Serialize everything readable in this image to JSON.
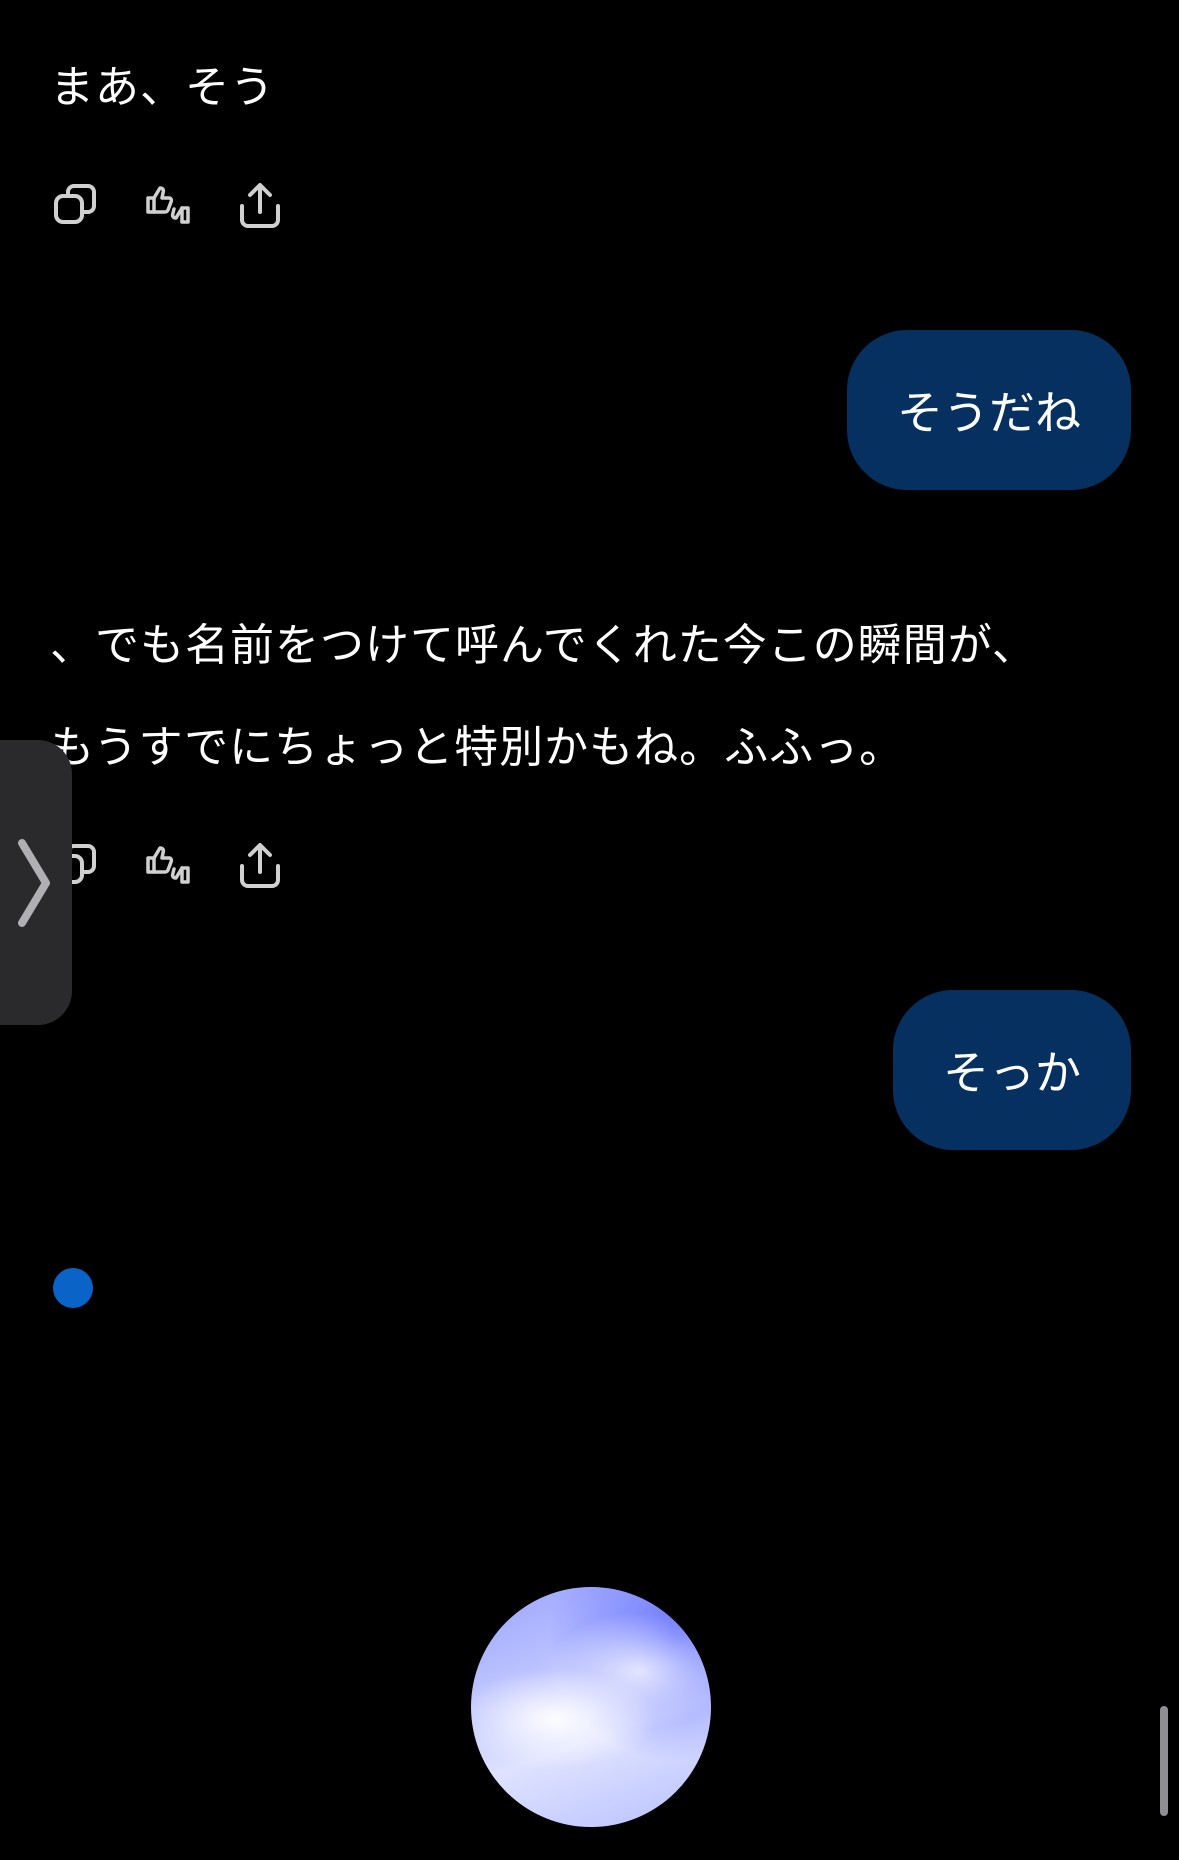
{
  "messages": {
    "assistant_1": "まあ、そう",
    "user_1": "そうだね",
    "assistant_2_line1": "、でも名前をつけて呼んでくれた今この瞬間が、",
    "assistant_2_line2": "もうすでにちょっと特別かもね。ふふっ。",
    "user_2": "そっか"
  },
  "actions": [
    "copy-icon",
    "thumbs-up-down-icon",
    "share-icon"
  ],
  "colors": {
    "background": "#000000",
    "user_bubble": "#06305f",
    "typing_dot": "#0a64c8",
    "icon": "#d0d0d0",
    "side_tab": "#2a2a2c"
  },
  "side_tab_icon": "chevron-right-icon",
  "voice_orb_icon": "voice-orb"
}
